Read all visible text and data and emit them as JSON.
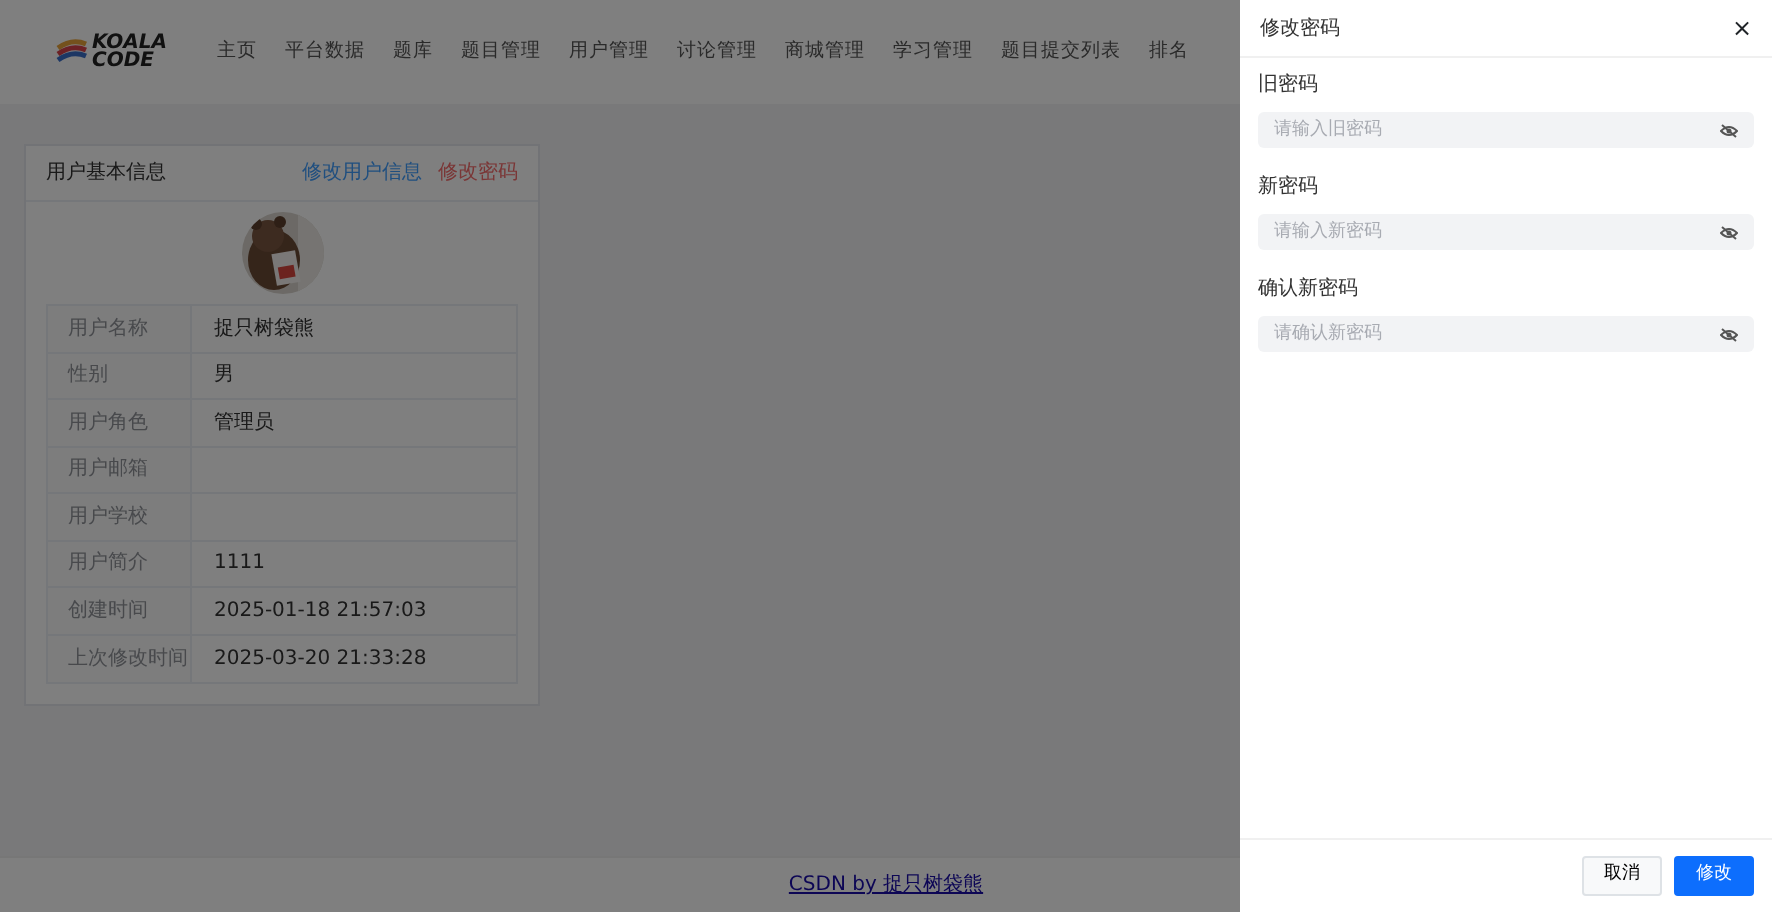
{
  "logo": {
    "line_1": "KOALA",
    "line_2": "CODE"
  },
  "nav": [
    {
      "label": "主页"
    },
    {
      "label": "平台数据"
    },
    {
      "label": "题库"
    },
    {
      "label": "题目管理"
    },
    {
      "label": "用户管理"
    },
    {
      "label": "讨论管理"
    },
    {
      "label": "商城管理"
    },
    {
      "label": "学习管理"
    },
    {
      "label": "题目提交列表"
    },
    {
      "label": "排名"
    }
  ],
  "profile_card": {
    "title": "用户基本信息",
    "edit_link": "修改用户信息",
    "password_link": "修改密码",
    "rows": [
      {
        "label": "用户名称",
        "value": "捉只树袋熊"
      },
      {
        "label": "性别",
        "value": "男"
      },
      {
        "label": "用户角色",
        "value": "管理员"
      },
      {
        "label": "用户邮箱",
        "value": ""
      },
      {
        "label": "用户学校",
        "value": ""
      },
      {
        "label": "用户简介",
        "value": "1111"
      },
      {
        "label": "创建时间",
        "value": "2025-01-18 21:57:03"
      },
      {
        "label": "上次修改时间",
        "value": "2025-03-20 21:33:28"
      }
    ]
  },
  "footer": {
    "link": "CSDN by 捉只树袋熊"
  },
  "drawer": {
    "title": "修改密码",
    "close": "×",
    "fields": [
      {
        "label": "旧密码",
        "placeholder": "请输入旧密码"
      },
      {
        "label": "新密码",
        "placeholder": "请输入新密码"
      },
      {
        "label": "确认新密码",
        "placeholder": "请确认新密码"
      }
    ],
    "buttons": [
      {
        "label": "取消",
        "kind": "secondary"
      },
      {
        "label": "修改",
        "kind": "primary"
      }
    ]
  }
}
